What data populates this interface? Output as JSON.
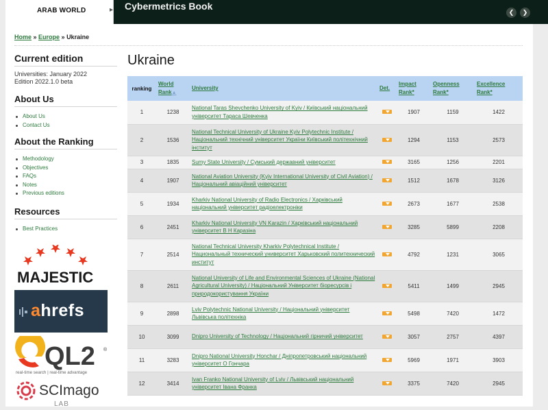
{
  "topbar": {
    "region_tab": "ARAB WORLD",
    "region_arrow": "▸",
    "title": "Cybermetrics Book",
    "prev_glyph": "❮",
    "next_glyph": "❯"
  },
  "breadcrumb": {
    "home": "Home",
    "sep1": " » ",
    "europe": "Europe",
    "sep2": " » ",
    "current": "Ukraine"
  },
  "sidebar": {
    "current_edition_heading": "Current edition",
    "edition_line1": "Universities: January 2022",
    "edition_line2": "Edition 2022.1.0 beta",
    "about_us_heading": "About Us",
    "about_us_items": [
      "About Us",
      "Contact Us"
    ],
    "about_ranking_heading": "About the Ranking",
    "about_ranking_items": [
      "Methodology",
      "Objectives",
      "FAQs",
      "Notes",
      "Previous editions"
    ],
    "resources_heading": "Resources",
    "resources_items": [
      "Best Practices"
    ]
  },
  "logos": {
    "majestic": "MAJESTIC",
    "ahrefs_a": "a",
    "ahrefs_rest": "hrefs",
    "ql2": "QL2",
    "ql2_registered": "®",
    "ql2_tagline": "real-time search | real-time advantage",
    "scimago": "SCImago",
    "scimago_lab": "LAB"
  },
  "colors": {
    "accent_green": "#2c7a3c",
    "header_blue": "#b9d3f2",
    "top_band": "#0c1f18",
    "detail_orange": "#f0a630"
  },
  "main": {
    "title": "Ukraine",
    "columns": {
      "ranking": "ranking",
      "world_rank_1": "World",
      "world_rank_2": "Rank",
      "university": "University",
      "det": "Det.",
      "impact_1": "Impact",
      "impact_2": "Rank*",
      "openness_1": "Openness",
      "openness_2": "Rank*",
      "excellence_1": "Excellence",
      "excellence_2": "Rank*"
    },
    "rows": [
      {
        "ranking": "1",
        "world_rank": "1238",
        "university": "National Taras Shevchenko University of Kyiv / Київський національний університет Тараса Шевченка",
        "impact": "1907",
        "openness": "1159",
        "excellence": "1422"
      },
      {
        "ranking": "2",
        "world_rank": "1536",
        "university": "National Technical University of Ukraine Kyiv Polytechnic Institute / Національний технічний університет України Київський політехнічний інститут",
        "impact": "1294",
        "openness": "1153",
        "excellence": "2573"
      },
      {
        "ranking": "3",
        "world_rank": "1835",
        "university": "Sumy State University / Сумський державний університет",
        "impact": "3165",
        "openness": "1256",
        "excellence": "2201"
      },
      {
        "ranking": "4",
        "world_rank": "1907",
        "university": "National Aviation University (Kyiv International University of Civil Aviation) / Національний авіаційний університет",
        "impact": "1512",
        "openness": "1678",
        "excellence": "3126"
      },
      {
        "ranking": "5",
        "world_rank": "1934",
        "university": "Kharkiv National University of Radio Electronics / Харківський національний університет радіоелектроніки",
        "impact": "2673",
        "openness": "1677",
        "excellence": "2538"
      },
      {
        "ranking": "6",
        "world_rank": "2451",
        "university": "Kharkiv National University VN Karazin / Харківський національний університет В Н Каразіна",
        "impact": "3285",
        "openness": "5899",
        "excellence": "2208"
      },
      {
        "ranking": "7",
        "world_rank": "2514",
        "university": "National Technical University Kharkiv Polytechnical Institute / Национальный технический университет Харьковский политехнический институт",
        "impact": "4792",
        "openness": "1231",
        "excellence": "3065"
      },
      {
        "ranking": "8",
        "world_rank": "2611",
        "university": "National University of Life and Environmental Sciences of Ukraine (National Agricultural University) / Національний Університет біоресурсів і природокористування України",
        "impact": "5411",
        "openness": "1499",
        "excellence": "2945"
      },
      {
        "ranking": "9",
        "world_rank": "2898",
        "university": "Lviv Polytechnic National University / Національний університет Львівська політехніка",
        "impact": "5498",
        "openness": "7420",
        "excellence": "1472"
      },
      {
        "ranking": "10",
        "world_rank": "3099",
        "university": "Dnipro University of Technology / Національний гірничий університет",
        "impact": "3057",
        "openness": "2757",
        "excellence": "4397"
      },
      {
        "ranking": "11",
        "world_rank": "3283",
        "university": "Dnipro National University Honchar / Дніпропетровський національний університет О Гончара",
        "impact": "5969",
        "openness": "1971",
        "excellence": "3903"
      },
      {
        "ranking": "12",
        "world_rank": "3414",
        "university": "Ivan Franko National University of Lviv / Львівський національний університет Івана Франка",
        "impact": "3375",
        "openness": "7420",
        "excellence": "2945"
      }
    ]
  }
}
